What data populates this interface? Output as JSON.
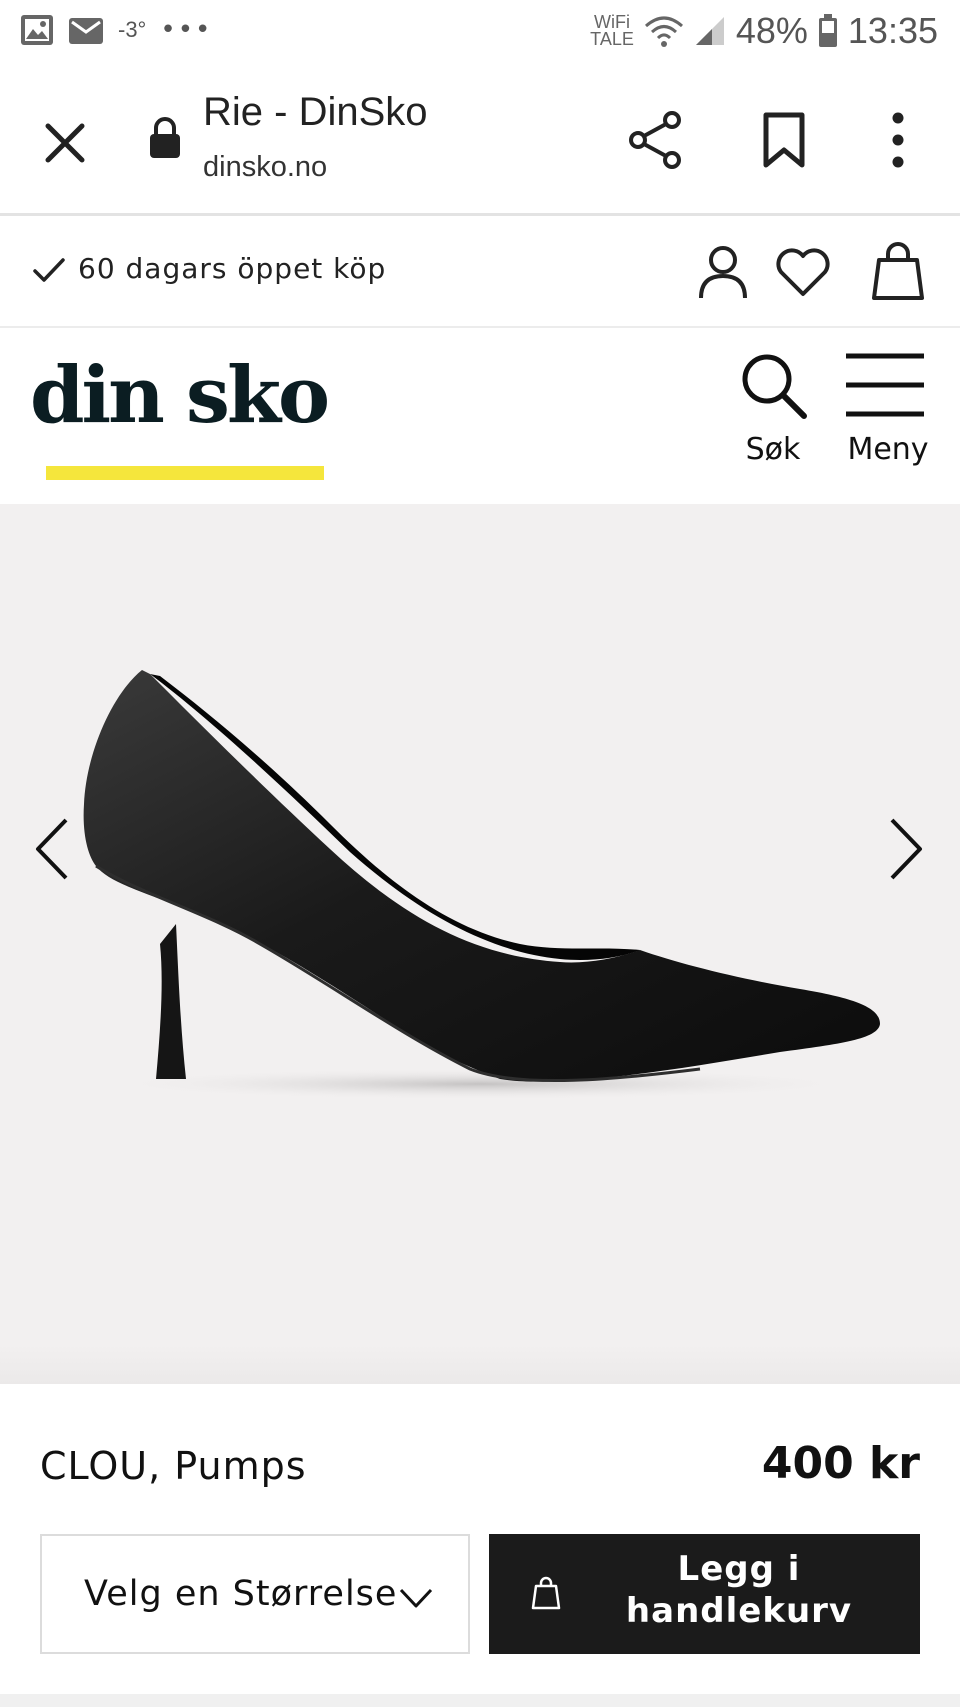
{
  "status_bar": {
    "temperature": "-3°",
    "more_dots": "•••",
    "wifi_label_1": "WiFi",
    "wifi_label_2": "TALE",
    "battery": "48%",
    "time": "13:35",
    "icons": [
      "gallery-icon",
      "email-icon",
      "wifi-icon",
      "signal-icon",
      "battery-icon"
    ]
  },
  "browser": {
    "title": "Rie - DinSko",
    "url": "dinsko.no",
    "icons": [
      "close-icon",
      "lock-icon",
      "share-icon",
      "bookmark-icon",
      "more-vert-icon"
    ]
  },
  "promo": {
    "text": "60 dagars öppet köp",
    "icons": [
      "check-icon",
      "account-icon",
      "heart-icon",
      "bag-icon"
    ]
  },
  "header": {
    "logo": "din sko",
    "search_label": "Søk",
    "menu_label": "Meny",
    "accent_color": "#f5e63c"
  },
  "gallery": {
    "background": "#f2f0f0",
    "icons": [
      "chevron-left-icon",
      "chevron-right-icon"
    ]
  },
  "product": {
    "name": "CLOU, Pumps",
    "price": "400 kr",
    "size_select_label": "Velg en Størrelse",
    "add_to_cart_line1": "Legg i",
    "add_to_cart_line2": "handlekurv",
    "button_color": "#1b1b1b"
  }
}
